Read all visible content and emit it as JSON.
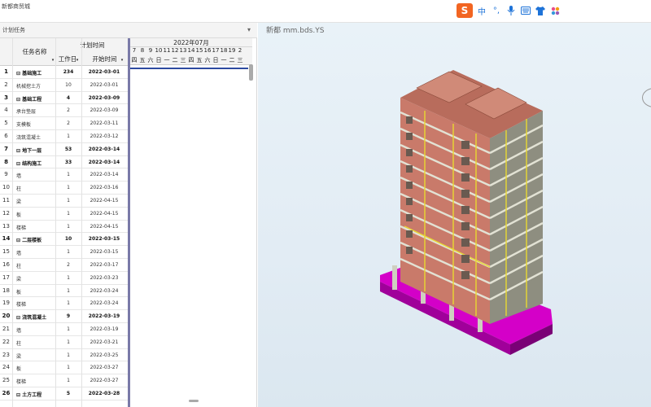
{
  "title": "新都商贸城",
  "ime": {
    "logo": "S",
    "items": [
      "中",
      "°,",
      "mic-icon",
      "keyboard-icon",
      "shirt-icon",
      "grid-icon"
    ]
  },
  "panel": {
    "label": "计划任务"
  },
  "grid": {
    "headers": {
      "name": "任务名称",
      "plan_group": "计划时间",
      "duration": "工作日",
      "start": "开始时间"
    },
    "rows": [
      {
        "n": "1",
        "name": "⊟ 基础施工",
        "dur": "234",
        "start": "2022-03-01",
        "bold": true
      },
      {
        "n": "2",
        "name": "机械挖土方",
        "dur": "10",
        "start": "2022-03-01",
        "bold": false
      },
      {
        "n": "3",
        "name": "⊟ 基础工程",
        "dur": "4",
        "start": "2022-03-09",
        "bold": true
      },
      {
        "n": "4",
        "name": "承台垫层",
        "dur": "2",
        "start": "2022-03-09",
        "bold": false
      },
      {
        "n": "5",
        "name": "支模板",
        "dur": "2",
        "start": "2022-03-11",
        "bold": false
      },
      {
        "n": "6",
        "name": "浇筑混凝土",
        "dur": "1",
        "start": "2022-03-12",
        "bold": false
      },
      {
        "n": "7",
        "name": "⊟ 地下一层",
        "dur": "53",
        "start": "2022-03-14",
        "bold": true
      },
      {
        "n": "8",
        "name": "⊟ 结构施工",
        "dur": "33",
        "start": "2022-03-14",
        "bold": true
      },
      {
        "n": "9",
        "name": "墙",
        "dur": "1",
        "start": "2022-03-14",
        "bold": false
      },
      {
        "n": "10",
        "name": "柱",
        "dur": "1",
        "start": "2022-03-16",
        "bold": false
      },
      {
        "n": "11",
        "name": "梁",
        "dur": "1",
        "start": "2022-04-15",
        "bold": false
      },
      {
        "n": "12",
        "name": "板",
        "dur": "1",
        "start": "2022-04-15",
        "bold": false
      },
      {
        "n": "13",
        "name": "楼梯",
        "dur": "1",
        "start": "2022-04-15",
        "bold": false
      },
      {
        "n": "14",
        "name": "⊟ 二层楼板",
        "dur": "10",
        "start": "2022-03-15",
        "bold": true
      },
      {
        "n": "15",
        "name": "墙",
        "dur": "1",
        "start": "2022-03-15",
        "bold": false
      },
      {
        "n": "16",
        "name": "柱",
        "dur": "2",
        "start": "2022-03-17",
        "bold": false
      },
      {
        "n": "17",
        "name": "梁",
        "dur": "1",
        "start": "2022-03-23",
        "bold": false
      },
      {
        "n": "18",
        "name": "板",
        "dur": "1",
        "start": "2022-03-24",
        "bold": false
      },
      {
        "n": "19",
        "name": "楼梯",
        "dur": "1",
        "start": "2022-03-24",
        "bold": false
      },
      {
        "n": "20",
        "name": "⊟ 浇筑混凝土",
        "dur": "9",
        "start": "2022-03-19",
        "bold": true
      },
      {
        "n": "21",
        "name": "墙",
        "dur": "1",
        "start": "2022-03-19",
        "bold": false
      },
      {
        "n": "22",
        "name": "柱",
        "dur": "1",
        "start": "2022-03-21",
        "bold": false
      },
      {
        "n": "23",
        "name": "梁",
        "dur": "1",
        "start": "2022-03-25",
        "bold": false
      },
      {
        "n": "24",
        "name": "板",
        "dur": "1",
        "start": "2022-03-27",
        "bold": false
      },
      {
        "n": "25",
        "name": "楼梯",
        "dur": "1",
        "start": "2022-03-27",
        "bold": false
      },
      {
        "n": "26",
        "name": "⊟ 土方工程",
        "dur": "5",
        "start": "2022-03-28",
        "bold": true
      }
    ]
  },
  "gantt": {
    "month": "2022年07月",
    "days": [
      "7",
      "8",
      "9",
      "10",
      "11",
      "12",
      "13",
      "14",
      "15",
      "16",
      "17",
      "18",
      "19",
      "2"
    ],
    "weekdays": [
      "四",
      "五",
      "六",
      "日",
      "一",
      "二",
      "三",
      "四",
      "五",
      "六",
      "日",
      "一",
      "二",
      "三"
    ]
  },
  "viewport": {
    "title": "新都 mm.bds.YS"
  },
  "colors": {
    "accent": "#2d4aa0",
    "wall": "#c97a6a",
    "slab": "#d8d8c8",
    "foundation": "#d400c8",
    "beam": "#e8d830"
  }
}
